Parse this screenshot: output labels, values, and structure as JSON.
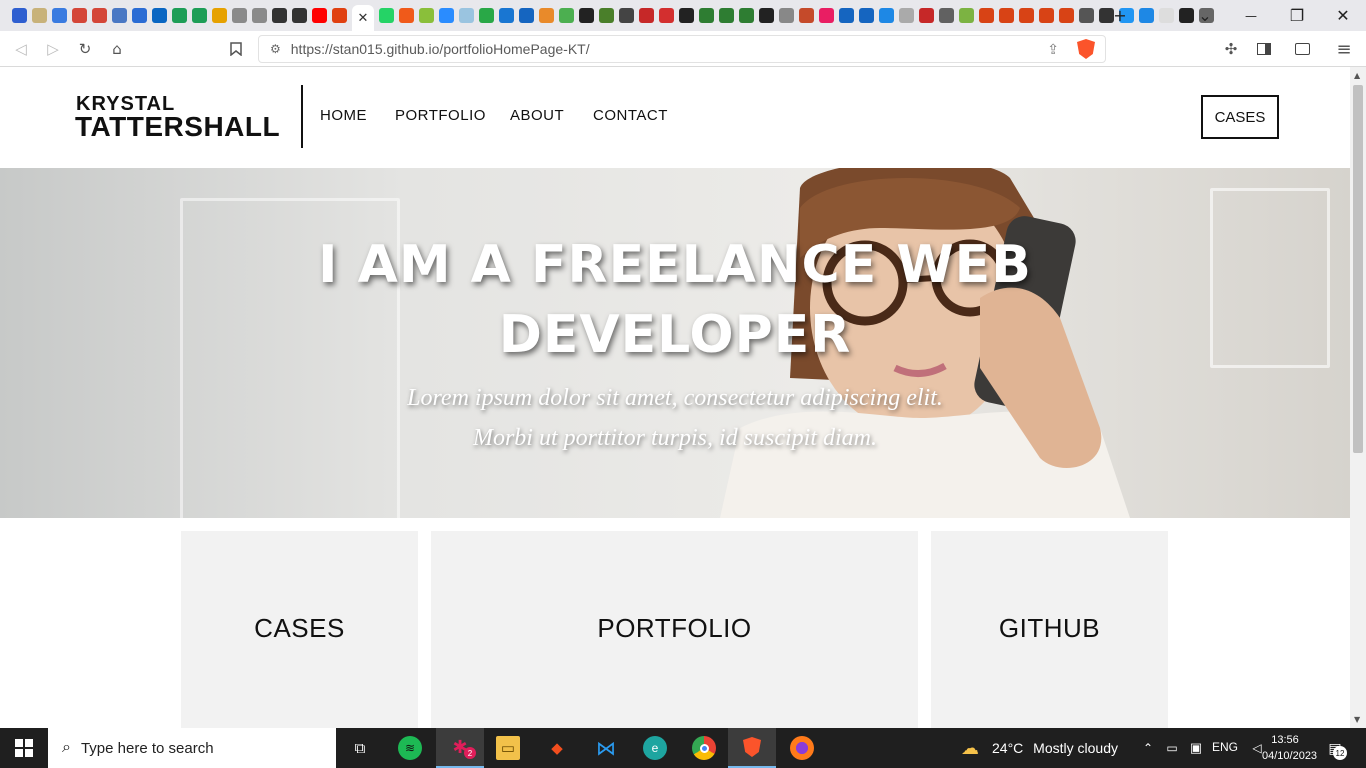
{
  "browser": {
    "tab_close": "✕",
    "new_tab": "+",
    "tab_list": "⌄",
    "minimize": "—",
    "maximize": "❐",
    "close": "✕",
    "url": "https://stan015.github.io/portfolioHomePage-KT/",
    "tab_colors": [
      "#2f5fd0",
      "#c8b27a",
      "#3a7be0",
      "#d44638",
      "#d44638",
      "#4a78c4",
      "#2b6cd4",
      "#0a66c2",
      "#1e9e57",
      "#1e9e57",
      "#e6a100",
      "#8a8a8a",
      "#8a8a8a",
      "#333333",
      "#333333",
      "#ff0000",
      "#e04010",
      "#25d366",
      "#f05a1a",
      "#8abf3a",
      "#2a8cff",
      "#9ac4e0",
      "#29a847",
      "#1976d2",
      "#1565c0",
      "#e98a2a",
      "#4caf50",
      "#222222",
      "#4a7f2a",
      "#444444",
      "#c62828",
      "#d32f2f",
      "#222222",
      "#2e7d32",
      "#2e7d32",
      "#2e7d32",
      "#222222",
      "#888888",
      "#c54a2a",
      "#e91e63",
      "#1565c0",
      "#1565c0",
      "#1e88e5",
      "#aaaaaa",
      "#c62828",
      "#616161",
      "#7cb342",
      "#d84315",
      "#d84315",
      "#d84315",
      "#d84315",
      "#d84315",
      "#555555",
      "#333333",
      "#2196f3",
      "#1e88e5",
      "#dddddd",
      "#222222",
      "#666666"
    ]
  },
  "site": {
    "brand_first": "KRYSTAL",
    "brand_last": "TATTERSHALL",
    "nav": [
      "HOME",
      "PORTFOLIO",
      "ABOUT",
      "CONTACT"
    ],
    "cta": "CASES",
    "hero_title_line1": "I AM A FREELANCE WEB",
    "hero_title_line2": "DEVELOPER",
    "hero_sub_line1": "Lorem ipsum dolor sit amet, consectetur adipiscing elit.",
    "hero_sub_line2": "Morbi ut porttitor turpis, id suscipit diam.",
    "cards": [
      "CASES",
      "PORTFOLIO",
      "GITHUB"
    ]
  },
  "taskbar": {
    "search_placeholder": "Type here to search",
    "weather_temp": "24°C",
    "weather_desc": "Mostly cloudy",
    "lang": "ENG",
    "time": "13:56",
    "date": "04/10/2023",
    "notif_count": "12",
    "badge_count": "2"
  }
}
